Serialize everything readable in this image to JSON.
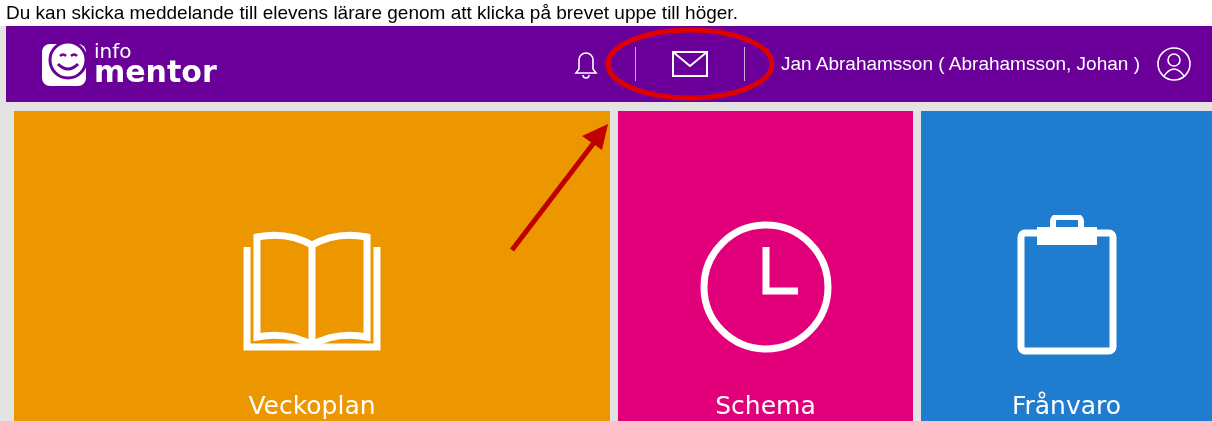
{
  "caption": "Du kan skicka meddelande till elevens lärare genom att klicka på brevet uppe till höger.",
  "header": {
    "logo_top": "info",
    "logo_bottom": "mentor",
    "user": "Jan Abrahamsson ( Abrahamsson, Johan )"
  },
  "tiles": [
    {
      "label": "Veckoplan",
      "kind": "book",
      "color": "#ec9600"
    },
    {
      "label": "Schema",
      "kind": "clock",
      "color": "#e2007a"
    },
    {
      "label": "Frånvaro",
      "kind": "clipboard",
      "color": "#1f7ccf"
    }
  ]
}
